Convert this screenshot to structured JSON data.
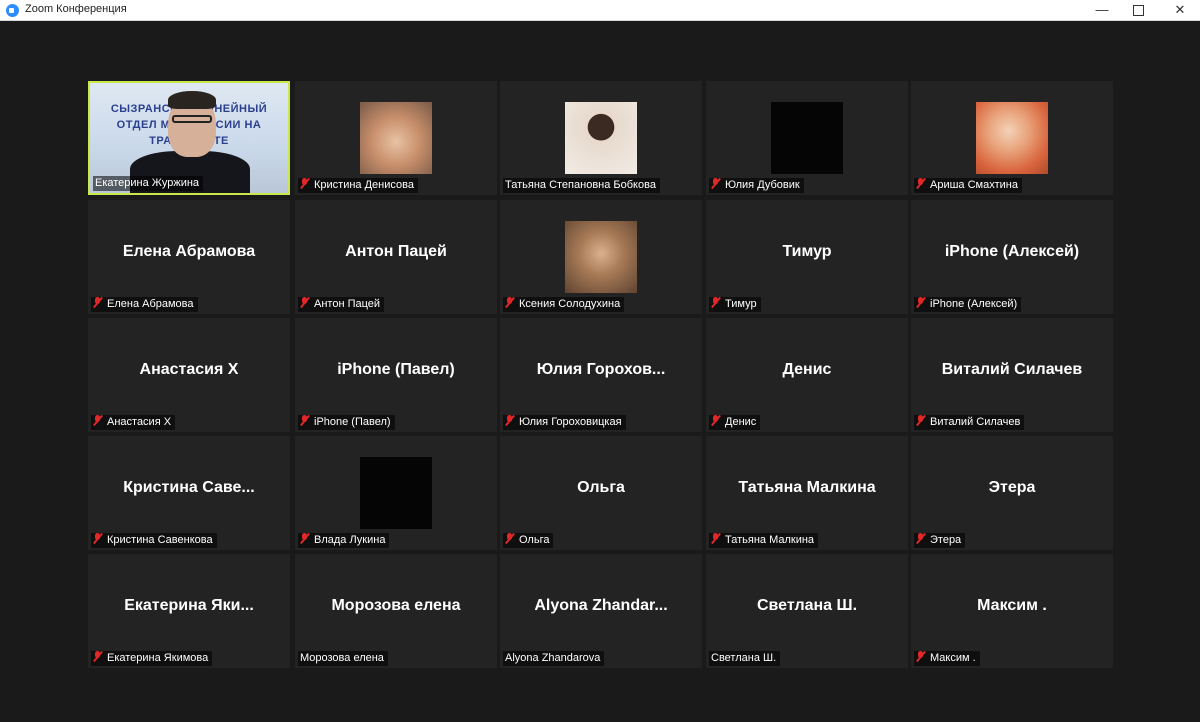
{
  "window": {
    "title": "Zoom Конференция",
    "min_glyph": "—",
    "close_glyph": "✕"
  },
  "participants": [
    {
      "display": "",
      "label": "Екатерина Журжина",
      "muted": false,
      "video": "speaker",
      "active": true,
      "banner": "СЫЗРАНСКИЙ ЛИНЕЙНЫЙ ОТДЕЛ МВД РОССИИ НА ТРАНСПОРТЕ"
    },
    {
      "display": "",
      "label": "Кристина Денисова",
      "muted": true,
      "video": "cat"
    },
    {
      "display": "",
      "label": "Татьяна Степановна Бобкова",
      "muted": false,
      "video": "woman"
    },
    {
      "display": "",
      "label": "Юлия Дубовик",
      "muted": true,
      "video": "black"
    },
    {
      "display": "",
      "label": "Ариша Смахтина",
      "muted": true,
      "video": "girl"
    },
    {
      "display": "Елена Абрамова",
      "label": "Елена Абрамова",
      "muted": true
    },
    {
      "display": "Антон Пацей",
      "label": "Антон Пацей",
      "muted": true
    },
    {
      "display": "",
      "label": "Ксения Солодухина",
      "muted": true,
      "video": "hamster"
    },
    {
      "display": "Тимур",
      "label": "Тимур",
      "muted": true
    },
    {
      "display": "iPhone (Алексей)",
      "label": "iPhone (Алексей)",
      "muted": true
    },
    {
      "display": "Анастасия Х",
      "label": "Анастасия Х",
      "muted": true
    },
    {
      "display": "iPhone (Павел)",
      "label": "iPhone (Павел)",
      "muted": true
    },
    {
      "display": "Юлия Горохов...",
      "label": "Юлия Гороховицкая",
      "muted": true
    },
    {
      "display": "Денис",
      "label": "Денис",
      "muted": true
    },
    {
      "display": "Виталий Силачев",
      "label": "Виталий Силачев",
      "muted": true
    },
    {
      "display": "Кристина Саве...",
      "label": "Кристина Савенкова",
      "muted": true
    },
    {
      "display": "",
      "label": "Влада Лукина",
      "muted": true,
      "video": "black"
    },
    {
      "display": "Ольга",
      "label": "Ольга",
      "muted": true
    },
    {
      "display": "Татьяна Малкина",
      "label": "Татьяна Малкина",
      "muted": true
    },
    {
      "display": "Этера",
      "label": "Этера",
      "muted": true
    },
    {
      "display": "Екатерина Яки...",
      "label": "Екатерина Якимова",
      "muted": true
    },
    {
      "display": "Морозова елена",
      "label": "Морозова елена",
      "muted": false
    },
    {
      "display": "Alyona Zhandar...",
      "label": "Alyona Zhandarova",
      "muted": false
    },
    {
      "display": "Светлана Ш.",
      "label": "Светлана Ш.",
      "muted": false
    },
    {
      "display": "Максим .",
      "label": "Максим .",
      "muted": true
    }
  ],
  "colors": {
    "background": "#1a1a1a",
    "tile": "#232323",
    "active_border": "#c9e84a",
    "mute": "#e02828"
  }
}
